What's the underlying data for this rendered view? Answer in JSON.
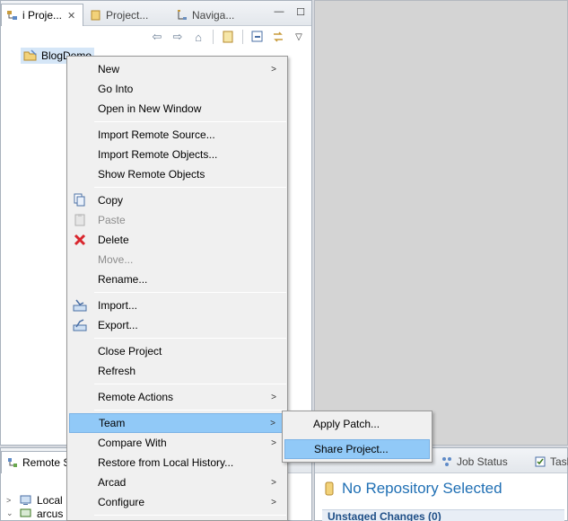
{
  "top_tabs": [
    {
      "label": "i Proje...",
      "icon": "project-explorer-icon",
      "active": true
    },
    {
      "label": "Project...",
      "icon": "package-icon",
      "active": false
    },
    {
      "label": "Naviga...",
      "icon": "navigator-icon",
      "active": false
    }
  ],
  "tree": {
    "project": "BlogDemo"
  },
  "bottom_left": {
    "tab": "Remote S",
    "rows": [
      {
        "label": "Local"
      },
      {
        "label": "arcus"
      }
    ]
  },
  "bottom_right": {
    "tabs": [
      "Job Status",
      "Task"
    ],
    "title": "No Repository Selected",
    "section": "Unstaged Changes (0)"
  },
  "menu": {
    "new": "New",
    "go_into": "Go Into",
    "open_new_window": "Open in New Window",
    "import_remote_source": "Import Remote Source...",
    "import_remote_objects": "Import Remote Objects...",
    "show_remote_objects": "Show Remote Objects",
    "copy": "Copy",
    "paste": "Paste",
    "delete": "Delete",
    "move": "Move...",
    "rename": "Rename...",
    "import": "Import...",
    "export": "Export...",
    "close_project": "Close Project",
    "refresh": "Refresh",
    "remote_actions": "Remote Actions",
    "team": "Team",
    "compare_with": "Compare With",
    "restore_local_history": "Restore from Local History...",
    "arcad": "Arcad",
    "configure": "Configure"
  },
  "submenu": {
    "apply_patch": "Apply Patch...",
    "share_project": "Share Project..."
  },
  "colors": {
    "highlight": "#91c9f7",
    "selection": "#d5e6f7",
    "title_blue": "#1f6fb4",
    "delete_red": "#d9272e"
  }
}
